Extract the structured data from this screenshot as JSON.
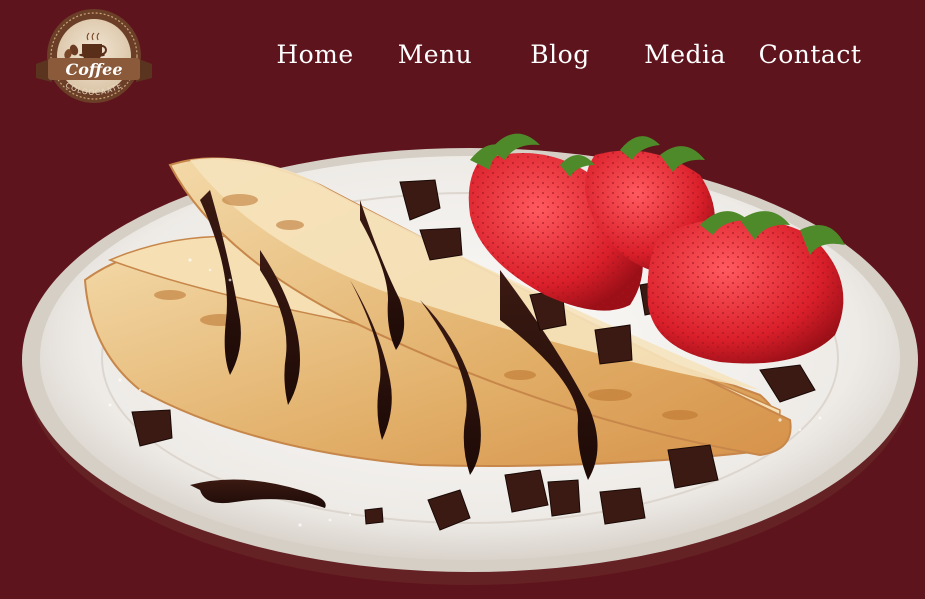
{
  "brand": {
    "logo_word": "Coffee",
    "logo_subtitle": "COLOOCAATE"
  },
  "nav": {
    "items": [
      {
        "label": "Home"
      },
      {
        "label": "Menu"
      },
      {
        "label": "Blog"
      },
      {
        "label": "Media"
      },
      {
        "label": "Contact"
      }
    ]
  },
  "colors": {
    "background": "#5e141c",
    "nav_text": "#ffffff",
    "logo_ring": "#6b3e28",
    "logo_banner": "#8a5a3a"
  },
  "hero": {
    "image_subject": "crepes with chocolate drizzle and strawberries on a plate"
  }
}
